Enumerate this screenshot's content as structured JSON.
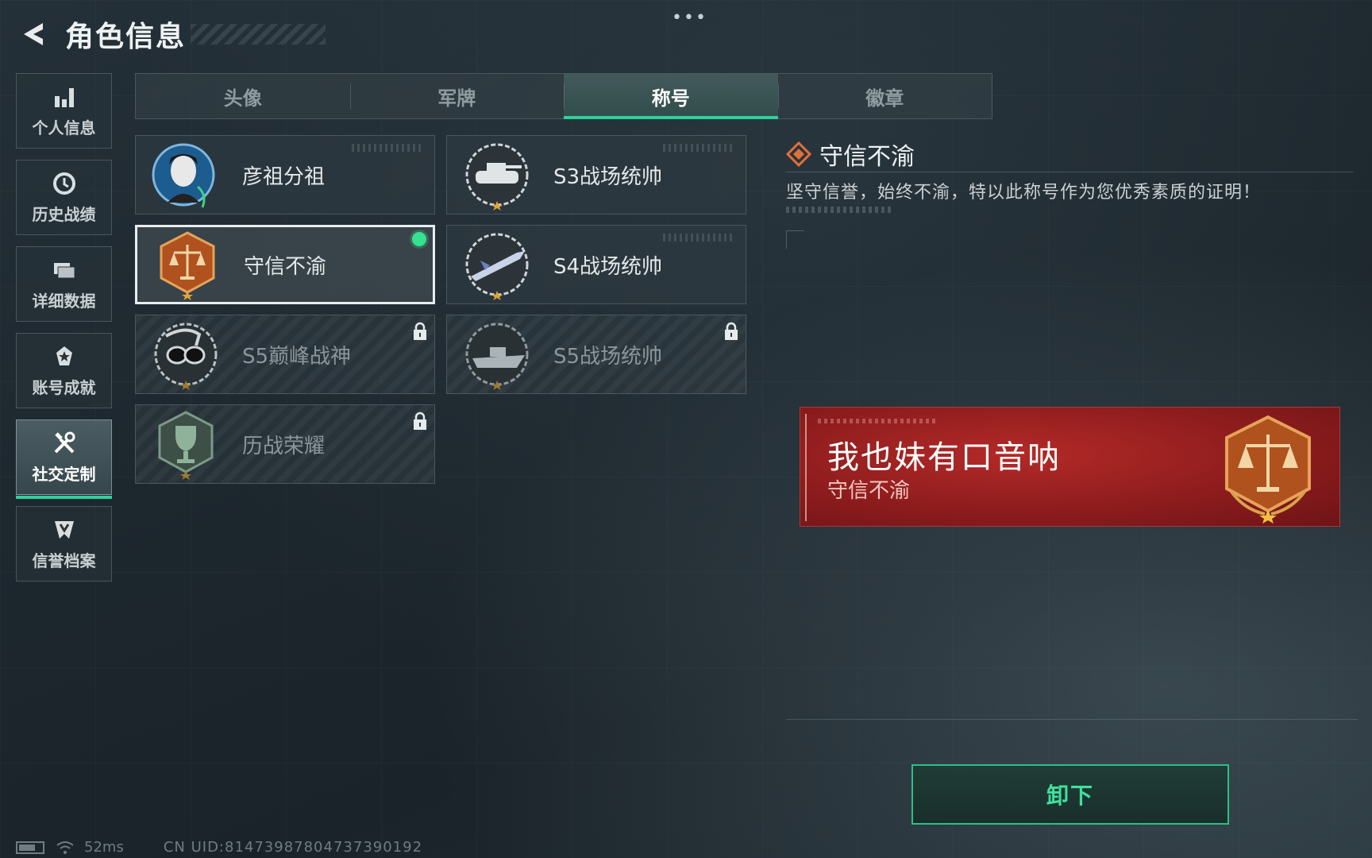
{
  "header": {
    "title": "角色信息"
  },
  "sidebar": {
    "items": [
      {
        "label": "个人信息",
        "icon": "bar-chart-icon",
        "active": false
      },
      {
        "label": "历史战绩",
        "icon": "history-clock-icon",
        "active": false
      },
      {
        "label": "详细数据",
        "icon": "folders-icon",
        "active": false
      },
      {
        "label": "账号成就",
        "icon": "medal-icon",
        "active": false
      },
      {
        "label": "社交定制",
        "icon": "tools-icon",
        "active": true
      },
      {
        "label": "信誉档案",
        "icon": "shield-badge-icon",
        "active": false
      }
    ]
  },
  "tabs": [
    {
      "label": "头像",
      "active": false
    },
    {
      "label": "军牌",
      "active": false
    },
    {
      "label": "称号",
      "active": true
    },
    {
      "label": "徽章",
      "active": false
    }
  ],
  "titles": [
    {
      "name": "彦祖分祖",
      "emblem": "portrait-emblem-icon",
      "locked": false,
      "selected": false
    },
    {
      "name": "S3战场统帅",
      "emblem": "tank-emblem-icon",
      "locked": false,
      "selected": false
    },
    {
      "name": "守信不渝",
      "emblem": "scales-emblem-icon",
      "locked": false,
      "selected": true,
      "equipped": true
    },
    {
      "name": "S4战场统帅",
      "emblem": "missile-emblem-icon",
      "locked": false,
      "selected": false
    },
    {
      "name": "S5巅峰战神",
      "emblem": "diver-mask-emblem-icon",
      "locked": true,
      "selected": false
    },
    {
      "name": "S5战场统帅",
      "emblem": "boat-emblem-icon",
      "locked": true,
      "selected": false
    },
    {
      "name": "历战荣耀",
      "emblem": "trophy-emblem-icon",
      "locked": true,
      "selected": false
    }
  ],
  "detail": {
    "title": "守信不渝",
    "description": "坚守信誉，始终不渝，特以此称号作为您优秀素质的证明！"
  },
  "banner": {
    "player_name": "我也妹有口音呐",
    "title": "守信不渝"
  },
  "actions": {
    "unequip_label": "卸下"
  },
  "status": {
    "ping": "52ms",
    "uid": "CN UID:814739878047373901​92"
  },
  "colors": {
    "accent": "#2fd09a",
    "banner": "#9b2022",
    "equipped_dot": "#35e08e"
  }
}
